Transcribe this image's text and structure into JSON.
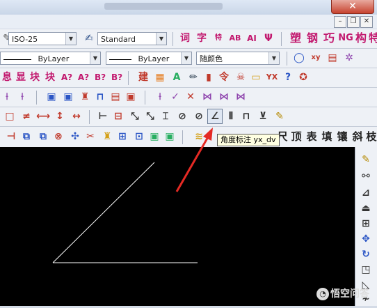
{
  "window": {
    "close_symbol": "✕",
    "min_symbol": "–",
    "restore_symbol": "❐",
    "mdi_close_symbol": "✕"
  },
  "toolbar_row1": {
    "dim_style": "ISO-25",
    "text_style": "Standard",
    "text_buttons": [
      "词",
      "字",
      "特",
      "AB",
      "AI",
      "Ψ"
    ],
    "big_text": [
      "塑",
      "钢",
      "巧",
      "NG",
      "构",
      "特"
    ]
  },
  "toolbar_row2": {
    "linetype": "ByLayer",
    "lineweight": "ByLayer",
    "color": "随颜色"
  },
  "toolbar_row6": {
    "text_buttons": [
      "顶",
      "表",
      "填",
      "镶",
      "斜",
      "枝"
    ]
  },
  "tooltip": {
    "text": "角度标注 yx_dv"
  },
  "watermark": {
    "text": "悟空问答"
  },
  "icons": {
    "row3": [
      "axis-icon",
      "display-icon",
      "function-icon",
      "function2-icon",
      "aq-icon",
      "aq2-icon",
      "bq-icon",
      "bq2-icon",
      "build-icon",
      "stack-icon",
      "edit-text-icon",
      "pencil-icon",
      "color-bar-icon",
      "order-icon",
      "skull-icon",
      "folder-icon",
      "yx-icon",
      "help-icon",
      "auto-icon"
    ],
    "row4": [
      "dim-icon",
      "dim2-icon",
      "computer-icon",
      "monitor-icon",
      "chair-icon",
      "door-icon",
      "cabinet-icon",
      "stamp-icon",
      "ruler-icon",
      "check-icon",
      "x-icon",
      "cut-icon",
      "cut2-icon",
      "cut3-icon"
    ],
    "row5": [
      "box-icon",
      "wall-icon",
      "line-icon",
      "height-icon",
      "fit-icon",
      "dim-linear-icon",
      "dim-width-icon",
      "dim-diag-icon",
      "dim-angle-icon",
      "dim-radius-icon",
      "circle-icon",
      "no-icon",
      "angle-dim-icon",
      "col-icon",
      "frame-icon",
      "pick-icon",
      "mark-icon"
    ],
    "row6": [
      "grip-icon",
      "bracket-icon",
      "doc-icon",
      "doc2-icon",
      "wheel-icon",
      "move-icon",
      "cut4-icon",
      "broom-icon",
      "new-doc-icon",
      "corner-icon",
      "save-icon",
      "save2-icon",
      "layers-icon"
    ],
    "right": [
      "pencil-right-icon",
      "copy-right-icon",
      "mirror-right-icon",
      "offset-right-icon",
      "array-right-icon",
      "move-right-icon",
      "rotate-right-icon",
      "scale-right-icon",
      "stretch-right-icon",
      "trim-right-icon"
    ]
  }
}
